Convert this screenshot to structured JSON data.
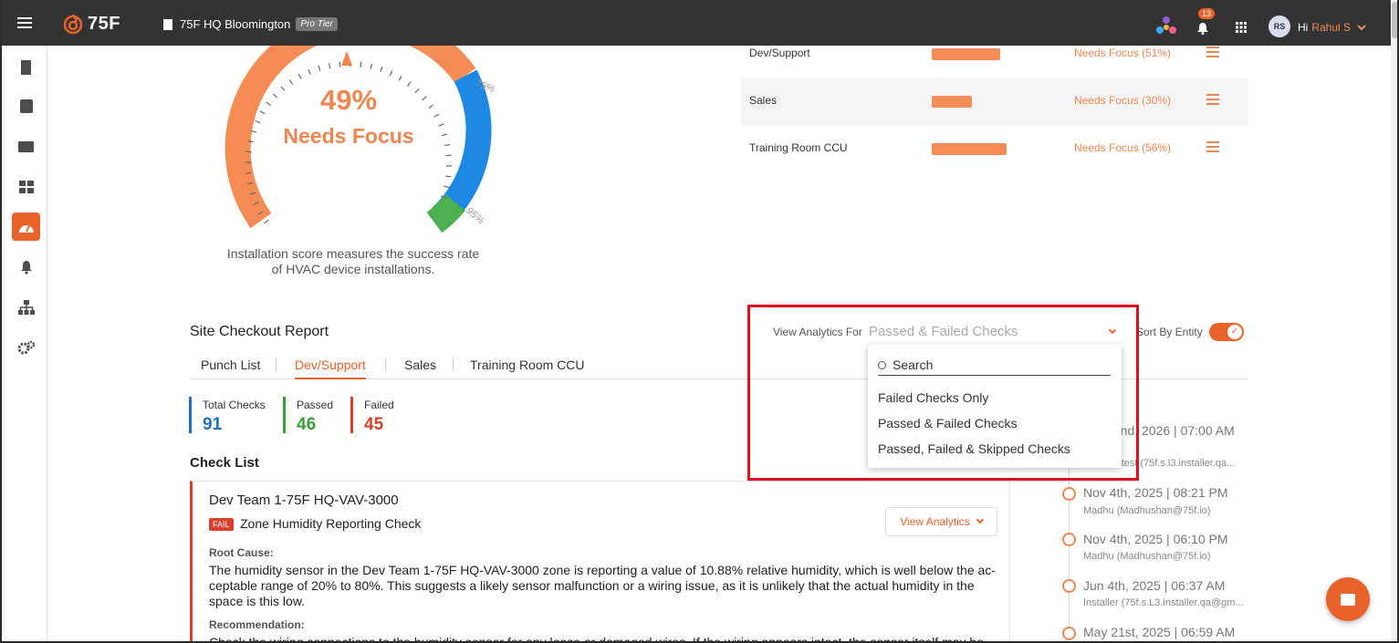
{
  "header": {
    "logo_text": "75F",
    "site_name": "75F HQ Bloomington",
    "tier": "Pro Tier",
    "notification_count": "13",
    "avatar_initials": "RS",
    "greeting": "Hi",
    "user_name": "Rahul S"
  },
  "sidebar": {
    "items": [
      {
        "icon": "building-icon"
      },
      {
        "icon": "calendar-check-icon"
      },
      {
        "icon": "laptop-icon"
      },
      {
        "icon": "dashboard-icon"
      },
      {
        "icon": "gauge-icon",
        "active": true
      },
      {
        "icon": "bell-icon"
      },
      {
        "icon": "sitemap-icon"
      },
      {
        "icon": "cogs-icon"
      }
    ]
  },
  "gauge": {
    "score_percent": 49,
    "score_text": "49%",
    "status": "Needs Focus",
    "mark_75": "75%",
    "mark_95": "95%",
    "caption_line1": "Installation score measures the success rate",
    "caption_line2": "of HVAC device installations."
  },
  "entities": [
    {
      "name": "Dev/Support",
      "status": "Needs Focus (51%)",
      "value": 51,
      "shaded": false
    },
    {
      "name": "Sales",
      "status": "Needs Focus (30%)",
      "value": 30,
      "shaded": true
    },
    {
      "name": "Training Room CCU",
      "status": "Needs Focus (56%)",
      "value": 56,
      "shaded": false
    }
  ],
  "report": {
    "title": "Site Checkout Report",
    "tabs": [
      "Punch List",
      "Dev/Support",
      "Sales",
      "Training Room CCU"
    ],
    "active_tab": "Dev/Support",
    "stats": {
      "total_label": "Total Checks",
      "total_value": "91",
      "passed_label": "Passed",
      "passed_value": "46",
      "failed_label": "Failed",
      "failed_value": "45"
    },
    "checklist_title": "Check List",
    "card": {
      "title": "Dev Team 1-75F HQ-VAV-3000",
      "badge": "FAIL",
      "check_name": "Zone Humidity Reporting Check",
      "view_analytics": "View Analytics",
      "root_cause_label": "Root Cause:",
      "root_cause_text": "The humidity sensor in the Dev Team 1-75F HQ-VAV-3000 zone is reporting a value of 10.88% relative humidity, which is well below the ac-ceptable range of 20% to 80%. This suggests a likely sensor malfunction or a wiring issue, as it is unlikely that the actual humidity in the space is this low.",
      "recommendation_label": "Recommendation:",
      "recommendation_text": "Check the wiring connections to the humidity sensor for any loose or damaged wires. If the wiring appears intact, the sensor itself may be"
    }
  },
  "analytics": {
    "label": "View Analytics For",
    "selected": "Passed & Failed Checks",
    "search_placeholder": "Search",
    "options": [
      "Failed Checks Only",
      "Passed & Failed Checks",
      "Passed, Failed & Skipped Checks"
    ],
    "sort_label": "Sort By Entity",
    "sort_enabled": true
  },
  "timeline": [
    {
      "date": "...nd, 2026 | 07:00 AM",
      "user": "Installer test (75f.s.l3.installer.qa..."
    },
    {
      "date": "Nov 4th, 2025 | 08:21 PM",
      "user": "Madhu (Madhushan@75f.io)"
    },
    {
      "date": "Nov 4th, 2025 | 06:10 PM",
      "user": "Madhu (Madhushan@75f.io)"
    },
    {
      "date": "Jun 4th, 2025 | 06:37 AM",
      "user": "Installer (75f.s.L3.installer.qa@gm..."
    },
    {
      "date": "May 21st, 2025 | 06:59 AM",
      "user": ""
    }
  ],
  "colors": {
    "accent": "#e9622a",
    "gauge_orange": "#f58c55",
    "gauge_blue": "#1e88e5",
    "gauge_green": "#4caf50",
    "fail_red": "#d6402c",
    "total_blue": "#1e6fc8",
    "passed_green": "#3a9d3a",
    "highlight_red": "#e0101e"
  }
}
